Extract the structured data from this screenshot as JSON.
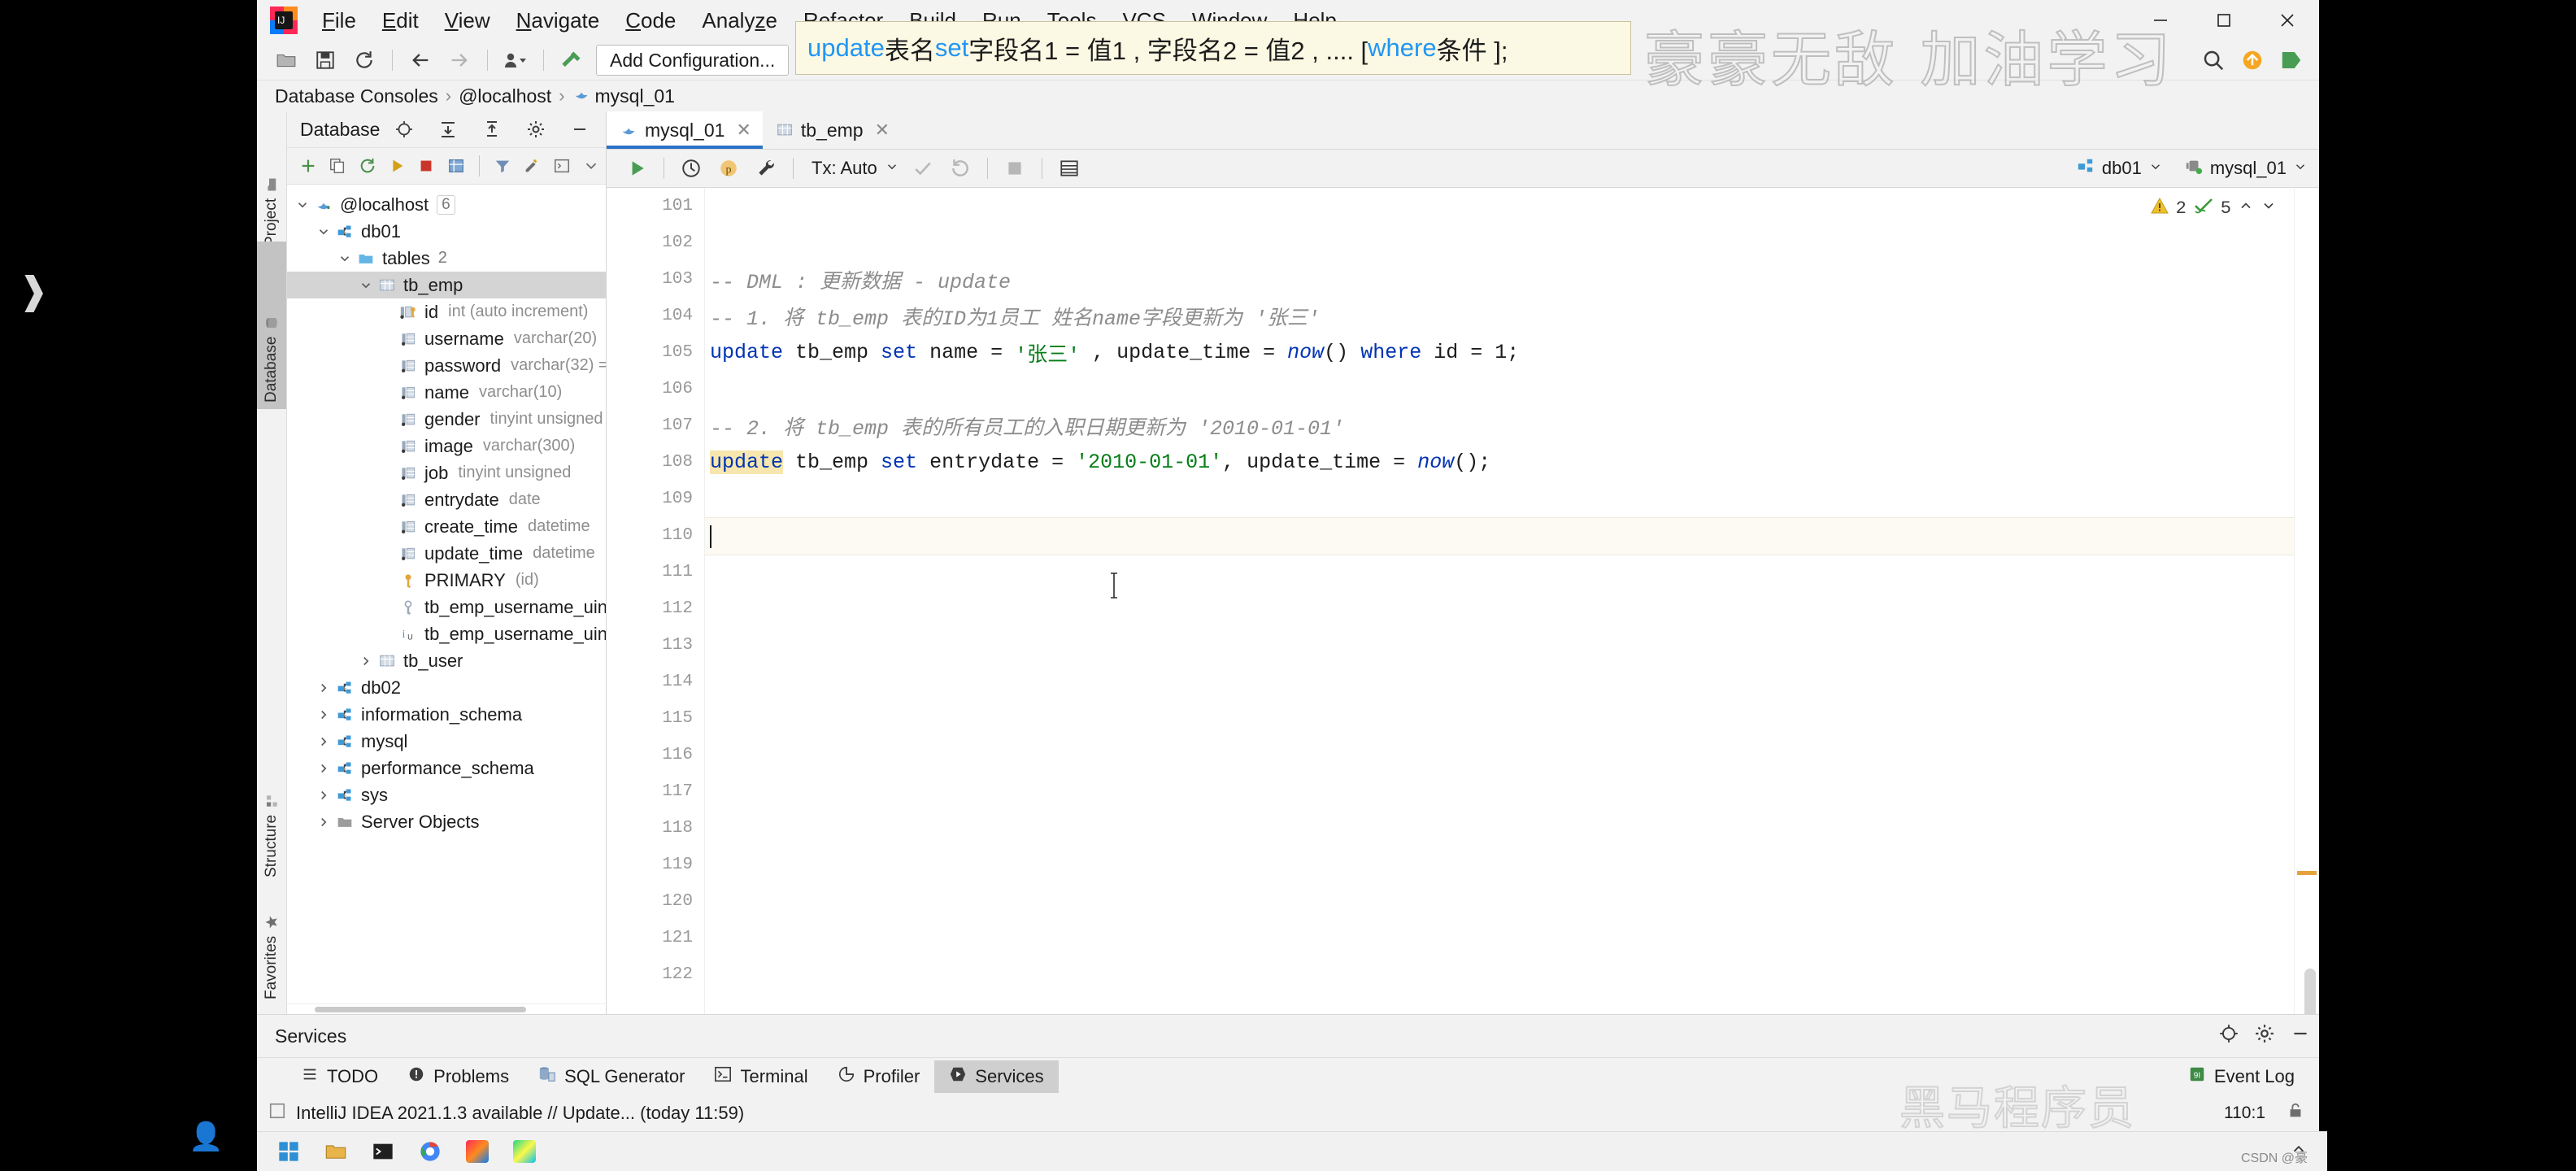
{
  "app": {
    "name": "IntelliJ IDEA",
    "logo_icon": "intellij-idea-logo"
  },
  "menubar": {
    "items": [
      {
        "label": "File",
        "mnemonic": "F"
      },
      {
        "label": "Edit",
        "mnemonic": "E"
      },
      {
        "label": "View",
        "mnemonic": "V"
      },
      {
        "label": "Navigate",
        "mnemonic": "N"
      },
      {
        "label": "Code",
        "mnemonic": "C"
      },
      {
        "label": "Analyze",
        "mnemonic": "z"
      },
      {
        "label": "Refactor",
        "mnemonic": "R"
      },
      {
        "label": "Build",
        "mnemonic": "B"
      },
      {
        "label": "Run",
        "mnemonic": "u"
      },
      {
        "label": "Tools",
        "mnemonic": "T"
      },
      {
        "label": "VCS",
        "mnemonic": "S"
      },
      {
        "label": "Window",
        "mnemonic": "W"
      },
      {
        "label": "Help",
        "mnemonic": "H"
      }
    ]
  },
  "window_controls": {
    "minimize": "minimize-icon",
    "maximize": "maximize-icon",
    "close": "close-icon"
  },
  "toolbar": {
    "open_label": "open-folder-icon",
    "save_label": "save-all-icon",
    "sync_label": "sync-icon",
    "back_label": "back-arrow-icon",
    "forward_label": "forward-arrow-icon",
    "profile_label": "user-profile-icon",
    "build_label": "build-hammer-icon",
    "add_configuration": "Add Configuration...",
    "run_label": "run-icon",
    "debug_label": "debug-icon",
    "search_label": "search-icon",
    "updates_label": "updates-icon",
    "ide_label": "ide-icon"
  },
  "breadcrumb": {
    "items": [
      "Database Consoles",
      "@localhost",
      "mysql_01"
    ],
    "separator": "›",
    "leaf_icon": "mysql-dolphin-icon"
  },
  "left_vertical_tabs": [
    {
      "label": "Project",
      "icon": "folder-icon",
      "selected": false
    },
    {
      "label": "Database",
      "icon": "database-icon",
      "selected": true
    }
  ],
  "left_vertical_tabs_bottom": [
    {
      "label": "Structure",
      "icon": "structure-icon",
      "selected": false
    },
    {
      "label": "Favorites",
      "icon": "star-icon",
      "selected": false
    }
  ],
  "database_panel": {
    "title": "Database",
    "actions": [
      "locate-icon",
      "expand-all-icon",
      "collapse-all-icon",
      "gear-icon",
      "hide-icon"
    ],
    "toolbar": [
      "add-icon",
      "copy-icon",
      "refresh-icon",
      "run-icon",
      "stop-icon",
      "table-icon",
      "filter-icon",
      "edit-icon",
      "console-icon",
      "more-icon"
    ],
    "tree": [
      {
        "label": "@localhost",
        "meta": "",
        "count": "6",
        "icon": "mysql-dolphin-icon",
        "indent": 0,
        "expanded": true,
        "selected": false,
        "has_arrow": true
      },
      {
        "label": "db01",
        "meta": "",
        "count": "",
        "icon": "schema-icon",
        "indent": 1,
        "expanded": true,
        "selected": false,
        "has_arrow": true
      },
      {
        "label": "tables",
        "meta": "",
        "count": "2",
        "icon": "folder-icon",
        "indent": 2,
        "expanded": true,
        "selected": false,
        "has_arrow": true
      },
      {
        "label": "tb_emp",
        "meta": "",
        "count": "",
        "icon": "table-icon",
        "indent": 3,
        "expanded": true,
        "selected": true,
        "has_arrow": true
      },
      {
        "label": "id",
        "meta": "int (auto increment)",
        "count": "",
        "icon": "column-key-icon",
        "indent": 4,
        "expanded": false,
        "selected": false,
        "has_arrow": false
      },
      {
        "label": "username",
        "meta": "varchar(20)",
        "count": "",
        "icon": "column-icon",
        "indent": 4,
        "expanded": false,
        "selected": false,
        "has_arrow": false
      },
      {
        "label": "password",
        "meta": "varchar(32) =",
        "count": "",
        "icon": "column-icon",
        "indent": 4,
        "expanded": false,
        "selected": false,
        "has_arrow": false
      },
      {
        "label": "name",
        "meta": "varchar(10)",
        "count": "",
        "icon": "column-icon",
        "indent": 4,
        "expanded": false,
        "selected": false,
        "has_arrow": false
      },
      {
        "label": "gender",
        "meta": "tinyint unsigned",
        "count": "",
        "icon": "column-icon",
        "indent": 4,
        "expanded": false,
        "selected": false,
        "has_arrow": false
      },
      {
        "label": "image",
        "meta": "varchar(300)",
        "count": "",
        "icon": "column-icon",
        "indent": 4,
        "expanded": false,
        "selected": false,
        "has_arrow": false
      },
      {
        "label": "job",
        "meta": "tinyint unsigned",
        "count": "",
        "icon": "column-icon",
        "indent": 4,
        "expanded": false,
        "selected": false,
        "has_arrow": false
      },
      {
        "label": "entrydate",
        "meta": "date",
        "count": "",
        "icon": "column-icon",
        "indent": 4,
        "expanded": false,
        "selected": false,
        "has_arrow": false
      },
      {
        "label": "create_time",
        "meta": "datetime",
        "count": "",
        "icon": "column-icon",
        "indent": 4,
        "expanded": false,
        "selected": false,
        "has_arrow": false
      },
      {
        "label": "update_time",
        "meta": "datetime",
        "count": "",
        "icon": "column-icon",
        "indent": 4,
        "expanded": false,
        "selected": false,
        "has_arrow": false
      },
      {
        "label": "PRIMARY",
        "meta": "(id)",
        "count": "",
        "icon": "primary-key-icon",
        "indent": 4,
        "expanded": false,
        "selected": false,
        "has_arrow": false
      },
      {
        "label": "tb_emp_username_uind",
        "meta": "",
        "count": "",
        "icon": "unique-key-icon",
        "indent": 4,
        "expanded": false,
        "selected": false,
        "has_arrow": false
      },
      {
        "label": "tb_emp_username_uind",
        "meta": "",
        "count": "",
        "icon": "index-icon",
        "indent": 4,
        "expanded": false,
        "selected": false,
        "has_arrow": false
      },
      {
        "label": "tb_user",
        "meta": "",
        "count": "",
        "icon": "table-icon",
        "indent": 3,
        "expanded": false,
        "selected": false,
        "has_arrow": true
      },
      {
        "label": "db02",
        "meta": "",
        "count": "",
        "icon": "schema-icon",
        "indent": 1,
        "expanded": false,
        "selected": false,
        "has_arrow": true
      },
      {
        "label": "information_schema",
        "meta": "",
        "count": "",
        "icon": "schema-icon",
        "indent": 1,
        "expanded": false,
        "selected": false,
        "has_arrow": true
      },
      {
        "label": "mysql",
        "meta": "",
        "count": "",
        "icon": "schema-icon",
        "indent": 1,
        "expanded": false,
        "selected": false,
        "has_arrow": true
      },
      {
        "label": "performance_schema",
        "meta": "",
        "count": "",
        "icon": "schema-icon",
        "indent": 1,
        "expanded": false,
        "selected": false,
        "has_arrow": true
      },
      {
        "label": "sys",
        "meta": "",
        "count": "",
        "icon": "schema-icon",
        "indent": 1,
        "expanded": false,
        "selected": false,
        "has_arrow": true
      },
      {
        "label": "Server Objects",
        "meta": "",
        "count": "",
        "icon": "folder-gray-icon",
        "indent": 1,
        "expanded": false,
        "selected": false,
        "has_arrow": true
      }
    ]
  },
  "editor": {
    "tabs": [
      {
        "label": "mysql_01",
        "icon": "mysql-dolphin-icon",
        "active": true,
        "closable": true
      },
      {
        "label": "tb_emp",
        "icon": "table-icon",
        "active": false,
        "closable": true
      }
    ],
    "run_toolbar": {
      "run": "run-icon",
      "history": "history-icon",
      "params": "parameters-icon",
      "settings": "wrench-icon",
      "tx_label": "Tx: Auto",
      "commit": "commit-check-icon",
      "rollback": "rollback-icon",
      "stop": "stop-icon",
      "output": "output-icon",
      "schema_label": "db01",
      "datasource_label": "mysql_01"
    },
    "inspection": {
      "warnings": "2",
      "warning_icon": "warning-triangle-icon",
      "checks": "5",
      "check_icon": "green-check-icon",
      "collapse_icon": "chevron-up-icon",
      "more_icon": "chevron-down-icon"
    },
    "first_line_number": 101,
    "lines": [
      {
        "n": 101,
        "segments": []
      },
      {
        "n": 102,
        "segments": []
      },
      {
        "n": 103,
        "segments": [
          {
            "t": "-- DML : 更新数据 - update",
            "c": "cm"
          }
        ]
      },
      {
        "n": 104,
        "segments": [
          {
            "t": "-- 1. 将 tb_emp 表的ID为1员工 姓名name字段更新为 '张三'",
            "c": "cm"
          }
        ]
      },
      {
        "n": 105,
        "segments": [
          {
            "t": "update",
            "c": "kw"
          },
          {
            "t": " tb_emp ",
            "c": "id"
          },
          {
            "t": "set",
            "c": "kw"
          },
          {
            "t": " name ",
            "c": "id"
          },
          {
            "t": "= ",
            "c": "id"
          },
          {
            "t": "'张三'",
            "c": "str"
          },
          {
            "t": " , update_time = ",
            "c": "id"
          },
          {
            "t": "now",
            "c": "fn"
          },
          {
            "t": "() ",
            "c": "id"
          },
          {
            "t": "where",
            "c": "kw"
          },
          {
            "t": " id = 1;",
            "c": "id"
          }
        ]
      },
      {
        "n": 106,
        "segments": []
      },
      {
        "n": 107,
        "segments": [
          {
            "t": "-- 2. 将 tb_emp 表的所有员工的入职日期更新为 '2010-01-01'",
            "c": "cm"
          }
        ]
      },
      {
        "n": 108,
        "gutter_icon": "green-check-icon",
        "segments": [
          {
            "t": "update",
            "c": "kw hl"
          },
          {
            "t": " tb_emp ",
            "c": "id"
          },
          {
            "t": "set",
            "c": "kw"
          },
          {
            "t": " entrydate ",
            "c": "id"
          },
          {
            "t": "= ",
            "c": "id"
          },
          {
            "t": "'2010-01-01'",
            "c": "str"
          },
          {
            "t": ", update_time = ",
            "c": "id"
          },
          {
            "t": "now",
            "c": "fn"
          },
          {
            "t": "();",
            "c": "id"
          }
        ]
      },
      {
        "n": 109,
        "segments": []
      },
      {
        "n": 110,
        "caret": true,
        "current": true,
        "segments": []
      },
      {
        "n": 111,
        "segments": []
      },
      {
        "n": 112,
        "segments": []
      },
      {
        "n": 113,
        "segments": []
      },
      {
        "n": 114,
        "segments": []
      },
      {
        "n": 115,
        "segments": []
      },
      {
        "n": 116,
        "segments": []
      },
      {
        "n": 117,
        "segments": []
      },
      {
        "n": 118,
        "segments": []
      },
      {
        "n": 119,
        "segments": []
      },
      {
        "n": 120,
        "segments": []
      },
      {
        "n": 121,
        "segments": []
      },
      {
        "n": 122,
        "segments": []
      }
    ]
  },
  "services_panel": {
    "title": "Services",
    "actions": [
      "locate-icon",
      "gear-icon",
      "hide-icon"
    ]
  },
  "bottom_tool_buttons": [
    {
      "label": "TODO",
      "icon": "todo-icon",
      "selected": false
    },
    {
      "label": "Problems",
      "icon": "problems-icon",
      "selected": false
    },
    {
      "label": "SQL Generator",
      "icon": "sql-generator-icon",
      "selected": false
    },
    {
      "label": "Terminal",
      "icon": "terminal-icon",
      "selected": false
    },
    {
      "label": "Profiler",
      "icon": "profiler-icon",
      "selected": false
    },
    {
      "label": "Services",
      "icon": "services-icon",
      "selected": true
    }
  ],
  "bottom_right": {
    "event_log_label": "Event Log",
    "event_log_icon": "event-log-icon"
  },
  "statusbar": {
    "message": "IntelliJ IDEA 2021.1.3 available // Update... (today 11:59)",
    "message_icon": "notification-icon",
    "caret_position": "110:1",
    "lock_icon": "lock-icon"
  },
  "tip_overlay": {
    "tokens": [
      {
        "t": "update",
        "k": "b"
      },
      {
        "t": " 表名 ",
        "k": "k"
      },
      {
        "t": "set",
        "k": "b"
      },
      {
        "t": " 字段名1 = 值1 , 字段名2 = 值2 , .... [ ",
        "k": "k"
      },
      {
        "t": "where",
        "k": "b"
      },
      {
        "t": " 条件 ];",
        "k": "k"
      }
    ],
    "background": "#fbf8e3",
    "accent": "#2196f3"
  },
  "watermarks": {
    "top": "豪豪无敌  加油学习",
    "bottom": "黑马程序员",
    "corner": "CSDN @豪"
  },
  "taskbar": {
    "start_icon": "windows-start-icon",
    "items": [
      "file-explorer-icon",
      "terminal-icon",
      "chrome-icon",
      "idea-icon",
      "pycharm-icon"
    ],
    "tray_icon": "show-desktop-icon"
  }
}
